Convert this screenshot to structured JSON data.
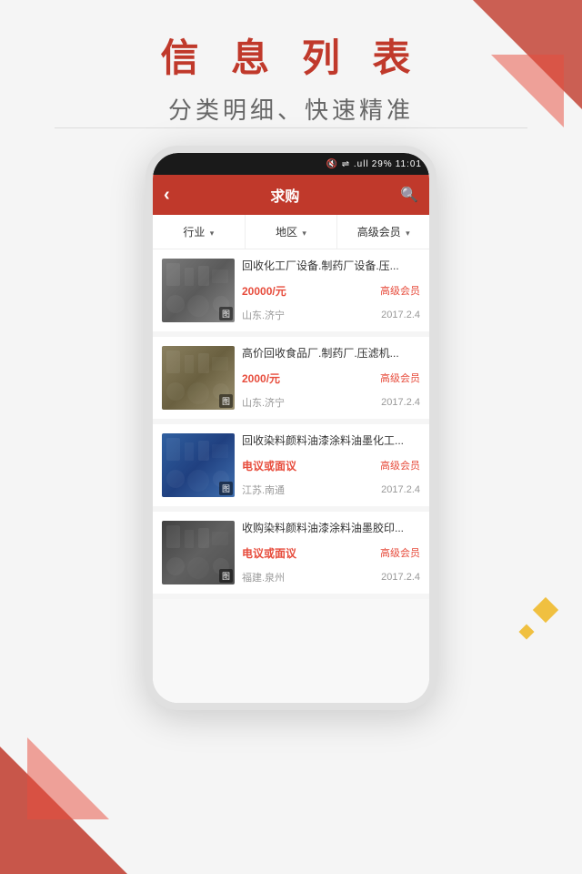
{
  "page": {
    "title_main": "信 息 列 表",
    "title_sub": "分类明细、快速精准"
  },
  "status_bar": {
    "battery": "29%",
    "time": "11:01",
    "signal_text": "▾ ⇌ .ull"
  },
  "header": {
    "back_icon": "‹",
    "title": "求购",
    "search_icon": "🔍"
  },
  "filters": [
    {
      "label": "行业",
      "arrow": "▾"
    },
    {
      "label": "地区",
      "arrow": "▾"
    },
    {
      "label": "高级会员",
      "arrow": "▾"
    }
  ],
  "listings": [
    {
      "title": "回收化工厂设备.制药厂设备.压...",
      "price": "20000/元",
      "badge": "高级会员",
      "location": "山东.济宁",
      "date": "2017.2.4",
      "thumb_class": "thumb-1"
    },
    {
      "title": "高价回收食品厂.制药厂.压滤机...",
      "price": "2000/元",
      "badge": "高级会员",
      "location": "山东.济宁",
      "date": "2017.2.4",
      "thumb_class": "thumb-2"
    },
    {
      "title": "回收染料颜料油漆涂料油墨化工...",
      "price": "电议或面议",
      "badge": "高级会员",
      "location": "江苏.南通",
      "date": "2017.2.4",
      "thumb_class": "thumb-3"
    },
    {
      "title": "收购染料颜料油漆涂料油墨胶印...",
      "price": "电议或面议",
      "badge": "高级会员",
      "location": "福建.泉州",
      "date": "2017.2.4",
      "thumb_class": "thumb-4"
    }
  ],
  "thumb_badge_label": "图"
}
